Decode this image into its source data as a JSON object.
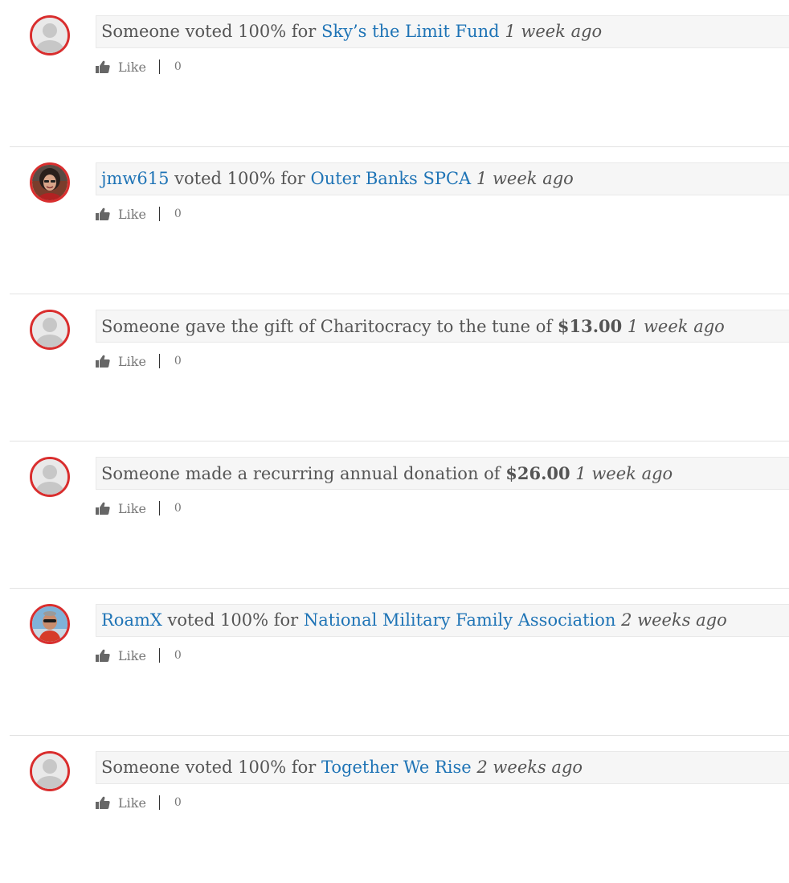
{
  "colors": {
    "link": "#1f74b6",
    "text": "#555555",
    "avatar_ring": "#d92e2e",
    "bubble_bg": "#f6f6f6",
    "divider": "#e3e3e3"
  },
  "icons": {
    "like": "thumbs-up-icon",
    "avatar_default": "default-user-icon"
  },
  "activities": [
    {
      "avatar": "default",
      "actor": "Someone",
      "verb": " voted 100% for ",
      "target": "Sky’s the Limit Fund",
      "time": "1 week ago",
      "like_label": "Like",
      "like_count": "0"
    },
    {
      "avatar": "photo-woman",
      "actor": "jmw615",
      "verb": " voted 100% for ",
      "target": "Outer Banks SPCA",
      "time": "1 week ago",
      "like_label": "Like",
      "like_count": "0"
    },
    {
      "avatar": "default",
      "text": "Someone gave the gift of Charitocracy to the tune of ",
      "amount": "$13.00",
      "time": "1 week ago",
      "like_label": "Like",
      "like_count": "0"
    },
    {
      "avatar": "default",
      "text": "Someone made a recurring annual donation of ",
      "amount": "$26.00",
      "time": "1 week ago",
      "like_label": "Like",
      "like_count": "0"
    },
    {
      "avatar": "photo-man",
      "actor": "RoamX",
      "verb": " voted 100% for ",
      "target": "National Military Family Association",
      "time": "2 weeks ago",
      "like_label": "Like",
      "like_count": "0"
    },
    {
      "avatar": "default",
      "actor": "Someone",
      "verb": " voted 100% for ",
      "target": "Together We Rise",
      "time": "2 weeks ago",
      "like_label": "Like",
      "like_count": "0"
    }
  ]
}
